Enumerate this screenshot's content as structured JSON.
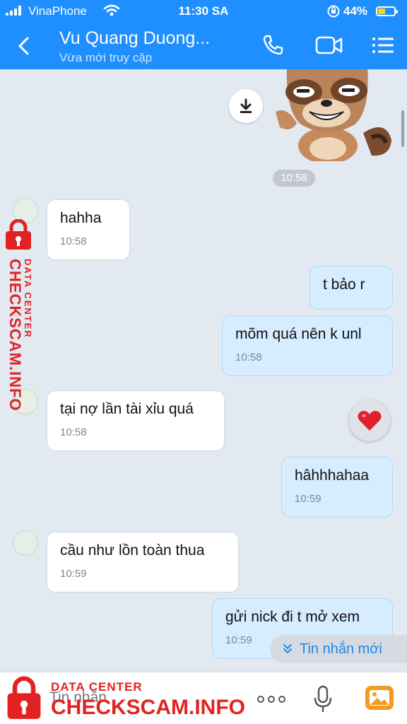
{
  "status_bar": {
    "carrier": "VinaPhone",
    "time": "11:30 SA",
    "battery": "44%",
    "battery_level": 0.44
  },
  "header": {
    "title": "Vu Quang Duong...",
    "subtitle": "Vừa mới truy cập",
    "icons": [
      "back-icon",
      "phone-icon",
      "video-call-icon",
      "menu-icon"
    ]
  },
  "chat": {
    "sticker_time": "10:58",
    "messages": [
      {
        "side": "in",
        "text": "hahha",
        "time": "10:58"
      },
      {
        "side": "out",
        "text": "t bảo r",
        "time": ""
      },
      {
        "side": "out",
        "text": "mõm quá nên k unl",
        "time": "10:58"
      },
      {
        "side": "in",
        "text": "tại nợ lần tài xỉu quá",
        "time": "10:58"
      },
      {
        "side": "out",
        "text": "hâhhhahaa",
        "time": "10:59"
      },
      {
        "side": "in",
        "text": "cầu như lồn toàn thua",
        "time": "10:59"
      },
      {
        "side": "out",
        "text": "gửi nick đi t mở xem",
        "time": "10:59"
      }
    ],
    "new_message_label": "Tin nhắn mới"
  },
  "composer": {
    "placeholder": "Tin nhắn"
  },
  "watermark": {
    "line1": "DATA CENTER",
    "line2": "CHECKSCAM.INFO"
  },
  "colors": {
    "header_bg": "#1f8fff",
    "chat_bg": "#e2e9f1",
    "bubble_out": "#d6ecff",
    "bubble_in": "#ffffff",
    "watermark": "#e22222"
  }
}
